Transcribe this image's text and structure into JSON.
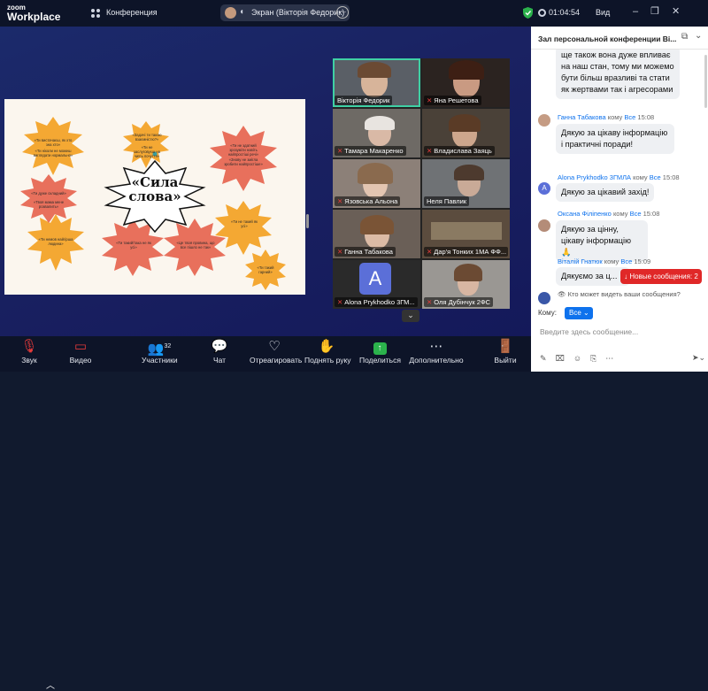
{
  "topbar": {
    "logo_small": "zoom",
    "logo_big": "Workplace",
    "conference_label": "Конференция",
    "share_label": "Экран (Вікторія Федорик)",
    "share_more": "···",
    "timer": "01:04:54",
    "view_label": "Вид"
  },
  "slide": {
    "title": "«Сила слова»",
    "phrases": [
      "«Ти вистачаєш, як хто зна хто»",
      "«Ти ніколи не можеш виглядати нормально»",
      "«Ти ніщо...»",
      "«Задачі ти такою взаємністю?»",
      "«Ти не заслуговуєш на чиїсь почуття»",
      "«Ти не здатний зрозуміти навіть найпростіші речі»",
      "«Знову не змігла зробити найпростіше»",
      "«Ти дуже складний»",
      "«Твоя мама мене розвалить»",
      "«Ти немов найгірша людина»",
      "«Ти такий/така не як усі»",
      "«Це твоя провина, що все пішло не так»",
      "«Ти такий гарний»",
      "«Ти не такий як усі»"
    ]
  },
  "gallery": {
    "participants": [
      {
        "name": "Вікторія Федорик",
        "muted": false
      },
      {
        "name": "Яна Решетова",
        "muted": true
      },
      {
        "name": "Тамара Макаренко",
        "muted": true
      },
      {
        "name": "Владислава Заяць",
        "muted": true
      },
      {
        "name": "Язовська Альона",
        "muted": true
      },
      {
        "name": "Неля Павлик",
        "muted": false
      },
      {
        "name": "Ганна Табакова",
        "muted": true
      },
      {
        "name": "Дар'я Тонких 1МА ФФ...",
        "muted": true
      },
      {
        "name": "Alona Prykhodko 3ГМ...",
        "muted": true
      },
      {
        "name": "Оля Дубінчук 2ФС",
        "muted": true
      }
    ],
    "avatar_letter": "A"
  },
  "toolbar": {
    "audio": "Звук",
    "video": "Видео",
    "participants": "Участники",
    "participants_count": "32",
    "chat": "Чат",
    "react": "Отреагировать",
    "raise": "Поднять руку",
    "share": "Поделиться",
    "more": "Дополнительно",
    "leave": "Выйти"
  },
  "chat": {
    "title": "Зал персональной конференции Ві...",
    "messages": [
      {
        "sender": "",
        "to": "",
        "time": "",
        "text": "ще також вона дуже впливає на наш стан, тому ми можемо бути більш вразливі та стати як жертвами так і агресорами"
      },
      {
        "sender": "Ганна Табакова",
        "to": "Все",
        "time": "15:08",
        "text": "Дякую за цікаву інформацію і практичні поради!"
      },
      {
        "sender": "Alona Prykhodko 3ГМЛА",
        "to": "Все",
        "time": "15:08",
        "text": "Дякую за цікавий захід!"
      },
      {
        "sender": "Оксана Філіпенко",
        "to": "Все",
        "time": "15:08",
        "text": "Дякую за цінну, цікаву інформацію 🙏"
      },
      {
        "sender": "Віталій Гнатюк",
        "to": "Все",
        "time": "15:09",
        "text": "Дякуємо за ц..."
      }
    ],
    "to_word": "кому",
    "new_messages": "Новые сообщения: 2",
    "who_can_see": "Кто может видеть ваши сообщения?",
    "to_label": "Кому:",
    "to_value": "Все",
    "input_placeholder": "Введите здесь сообщение..."
  }
}
